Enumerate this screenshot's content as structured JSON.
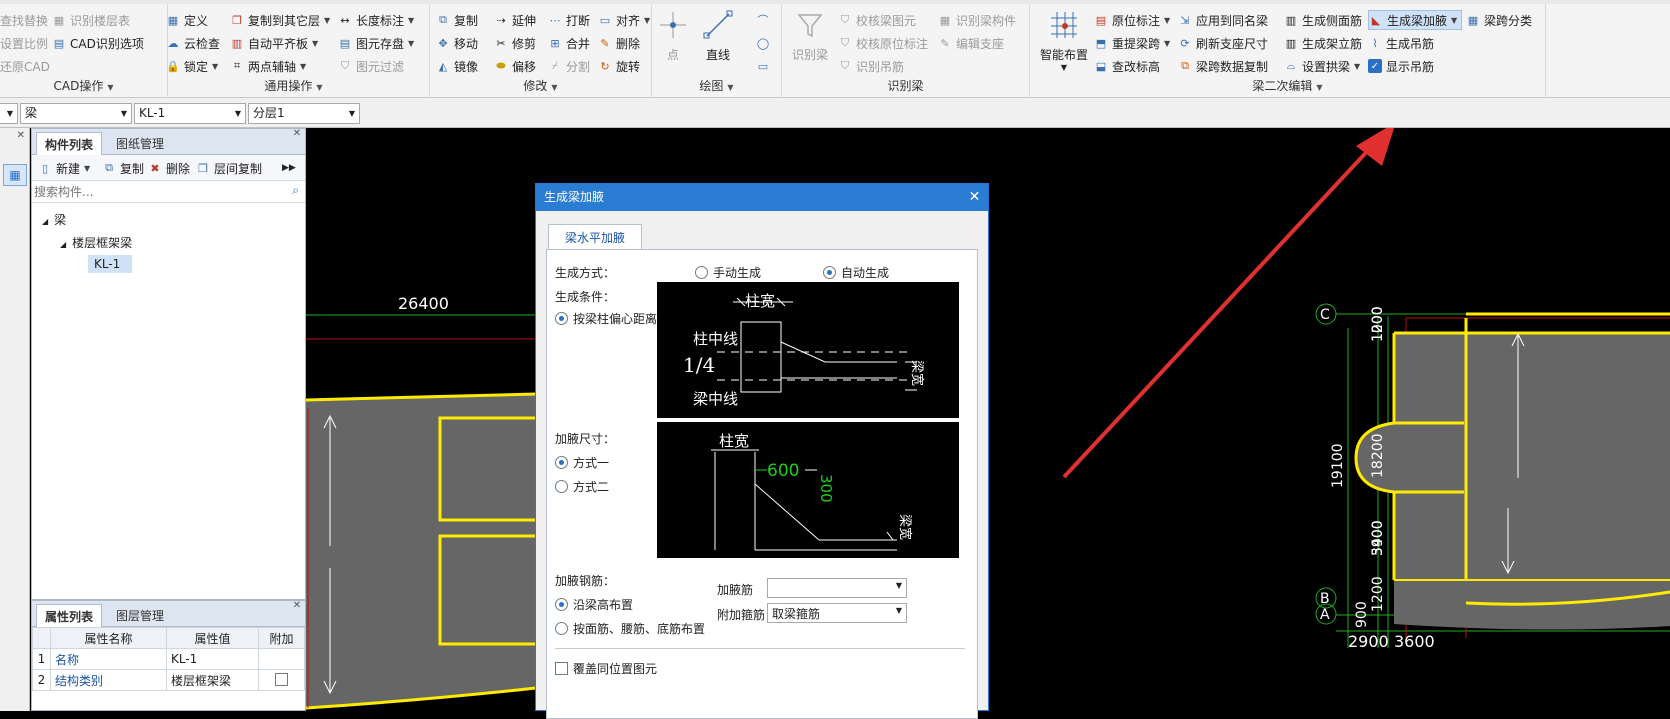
{
  "ribbon": {
    "cad": {
      "title": "CAD操作",
      "items": [
        "查找替换",
        "识别楼层表",
        "设置比例",
        "CAD识别选项",
        "还原CAD"
      ]
    },
    "general": {
      "title": "通用操作",
      "items": [
        "定义",
        "复制到其它层",
        "长度标注",
        "云检查",
        "自动平齐板",
        "图元存盘",
        "锁定",
        "两点辅轴",
        "图元过滤"
      ]
    },
    "modify": {
      "title": "修改",
      "items": [
        "复制",
        "延伸",
        "打断",
        "对齐",
        "移动",
        "修剪",
        "合并",
        "删除",
        "镜像",
        "偏移",
        "分割",
        "旋转"
      ]
    },
    "draw": {
      "title": "绘图",
      "items": [
        "点",
        "直线"
      ]
    },
    "recognize": {
      "title": "识别梁",
      "items": [
        "识别梁",
        "校核梁图元",
        "识别梁构件",
        "校核原位标注",
        "编辑支座",
        "识别吊筋"
      ]
    },
    "beam2": {
      "title": "梁二次编辑",
      "items": [
        "智能布置",
        "原位标注",
        "应用到同名梁",
        "生成侧面筋",
        "生成梁加腋",
        "梁跨分类",
        "重提梁跨",
        "刷新支座尺寸",
        "生成架立筋",
        "生成吊筋",
        "查改标高",
        "梁跨数据复制",
        "设置拱梁",
        "显示吊筋"
      ]
    }
  },
  "toolbar2": {
    "type_value": "梁",
    "name_value": "KL-1",
    "layer_value": "分层1"
  },
  "component_panel": {
    "tabs": [
      "构件列表",
      "图纸管理"
    ],
    "toolbar": [
      "新建",
      "复制",
      "删除",
      "层间复制"
    ],
    "search_placeholder": "搜索构件...",
    "tree": [
      "梁",
      "楼层框架梁",
      "KL-1"
    ]
  },
  "property_panel": {
    "tabs": [
      "属性列表",
      "图层管理"
    ],
    "headers": [
      "属性名称",
      "属性值",
      "附加"
    ],
    "rows": [
      {
        "num": "1",
        "name": "名称",
        "value": "KL-1"
      },
      {
        "num": "2",
        "name": "结构类别",
        "value": "楼层框架梁"
      }
    ]
  },
  "canvas": {
    "dims_left": [
      "26400",
      "26400"
    ],
    "axis_labels": [
      "C",
      "B",
      "A"
    ],
    "dims_right_v": [
      "1200",
      "1000",
      "19100",
      "18200",
      "5900",
      "3400",
      "1200",
      "900"
    ],
    "dims_right_h": [
      "2900",
      "3600"
    ]
  },
  "dialog": {
    "title": "生成梁加腋",
    "tab": "梁水平加腋",
    "gen_method_label": "生成方式：",
    "manual": "手动生成",
    "auto": "自动生成",
    "condition_label": "生成条件：",
    "condition_opt": "按梁柱偏心距离",
    "size_label": "加腋尺寸：",
    "size_opt1": "方式一",
    "size_opt2": "方式二",
    "rebar_label": "加腋钢筋：",
    "rebar_opt1": "沿梁高布置",
    "rebar_opt2": "按面筋、腰筋、底筋布置",
    "haunch_rebar_label": "加腋筋",
    "haunch_rebar_value": "",
    "stirrup_label": "附加箍筋",
    "stirrup_value": "取梁箍筋",
    "overwrite_label": "覆盖同位置图元",
    "diagram1": {
      "col_width": "柱宽",
      "col_center": "柱中线",
      "ratio": "1/4",
      "beam_center": "梁中线",
      "beam_width": "梁宽"
    },
    "diagram2": {
      "col_width": "柱宽",
      "len": "600",
      "width": "300",
      "beam_width": "梁宽"
    }
  },
  "colors": {
    "accent": "#2b7cd3",
    "beam_yellow": "#ffea00",
    "red_line": "#e03030"
  }
}
